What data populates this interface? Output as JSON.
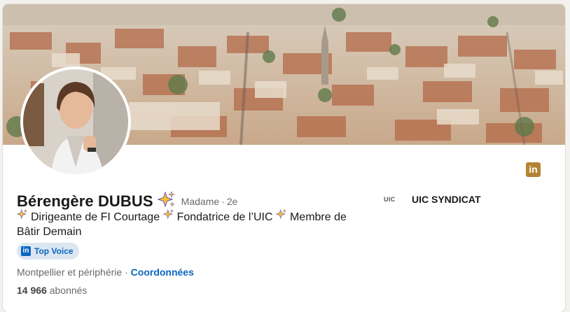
{
  "profile": {
    "name": "Bérengère DUBUS",
    "pronouns": "Madame",
    "degree_separator": "·",
    "degree": "2e",
    "headline_parts": [
      "Dirigeante de FI Courtage",
      "Fondatrice de l’UIC",
      "Membre de Bâtir Demain"
    ],
    "badge_label": "Top Voice",
    "badge_logo": "in",
    "location": "Montpellier et périphérie",
    "location_separator": "·",
    "contact_link": "Coordonnées",
    "followers_count": "14 966",
    "followers_label": "abonnés"
  },
  "experience": {
    "company_logo_text": "UIC",
    "company_name": "UIC SYNDICAT"
  },
  "icons": {
    "linkedin_badge": "in",
    "sparkle": "sparkles-emoji"
  },
  "colors": {
    "linkedin_blue": "#0a66c2",
    "badge_gold": "#b48333",
    "sparkle_yellow": "#f7c52b"
  }
}
